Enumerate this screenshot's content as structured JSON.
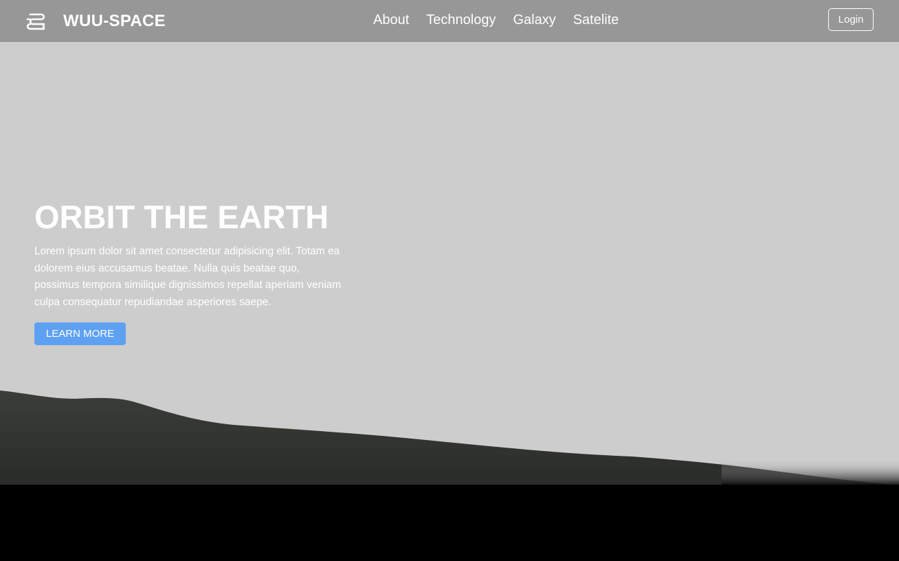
{
  "brand": {
    "name": "WUU-SPACE",
    "logo_icon": "wave-logo-icon"
  },
  "nav": {
    "items": [
      {
        "label": "About"
      },
      {
        "label": "Technology"
      },
      {
        "label": "Galaxy"
      },
      {
        "label": "Satelite"
      }
    ],
    "login_label": "Login"
  },
  "hero": {
    "title": "ORBIT THE EARTH",
    "description": "Lorem ipsum dolor sit amet consectetur adipisicing elit. Totam ea dolorem eius accusamus beatae. Nulla quis beatae quo, possimus tempora similique dignissimos repellat aperiam veniam culpa consequatur repudiandae asperiores saepe.",
    "cta_label": "LEARN MORE"
  },
  "colors": {
    "sky": "#cdcdcd",
    "navbar": "#979797",
    "accent": "#5ea1f3",
    "terrain": "#3a3c38",
    "ground": "#000000"
  }
}
